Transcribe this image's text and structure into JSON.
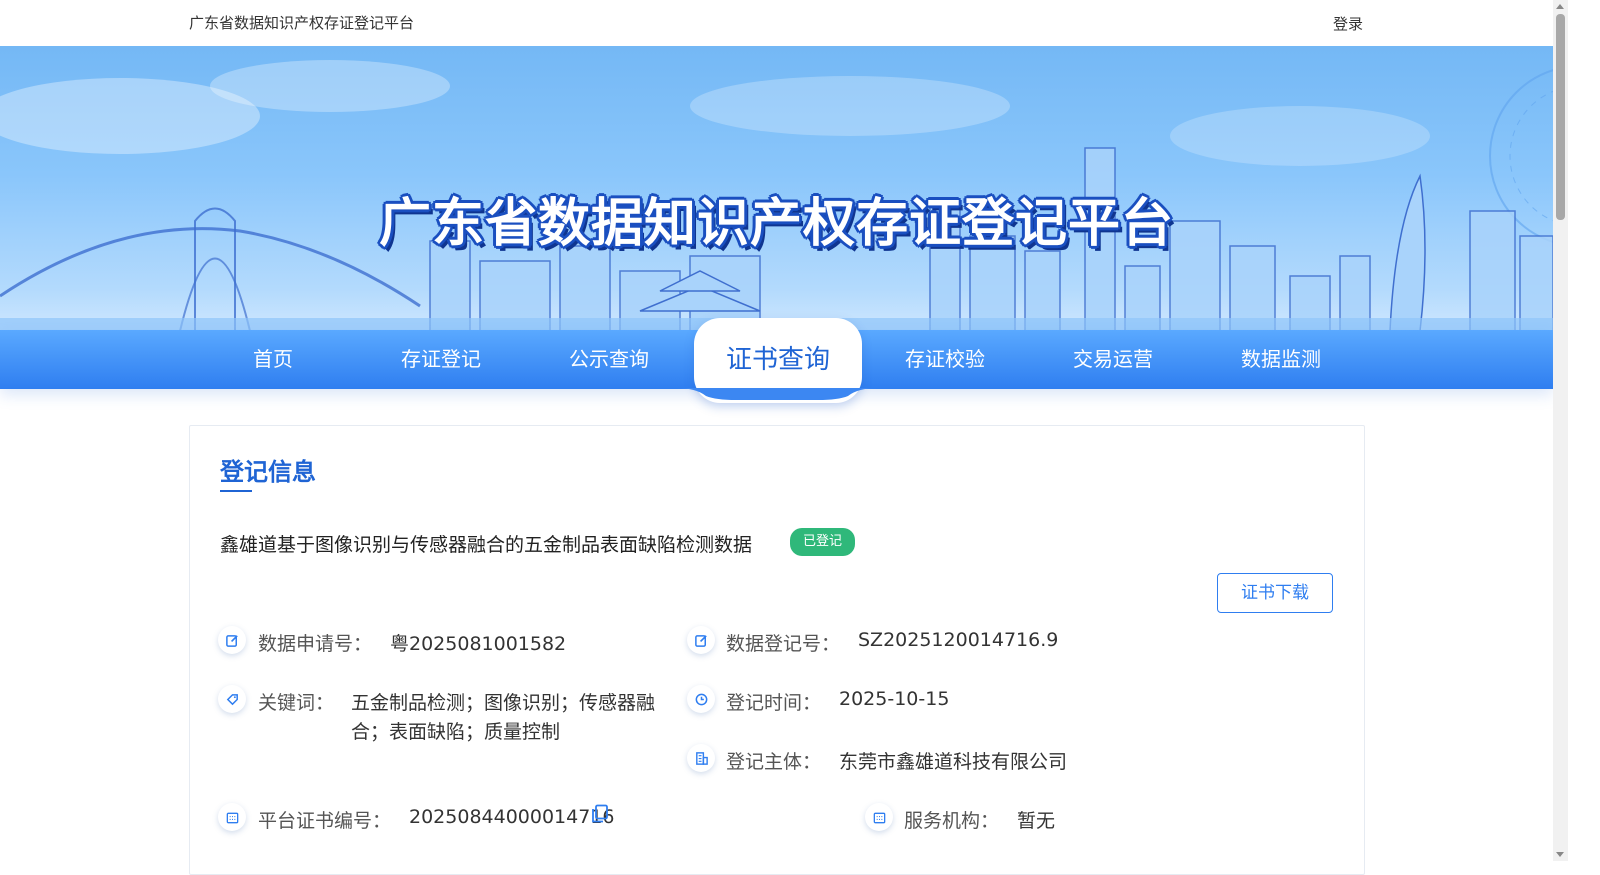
{
  "topbar": {
    "site_title": "广东省数据知识产权存证登记平台",
    "login_label": "登录"
  },
  "banner": {
    "title": "广东省数据知识产权存证登记平台"
  },
  "nav": {
    "items": [
      {
        "label": "首页",
        "active": false
      },
      {
        "label": "存证登记",
        "active": false
      },
      {
        "label": "公示查询",
        "active": false
      },
      {
        "label": "证书查询",
        "active": true
      },
      {
        "label": "存证校验",
        "active": false
      },
      {
        "label": "交易运营",
        "active": false
      },
      {
        "label": "数据监测",
        "active": false
      }
    ]
  },
  "section": {
    "title": "登记信息",
    "data_name": "鑫雄道基于图像识别与传感器融合的五金制品表面缺陷检测数据",
    "status": "已登记",
    "download_label": "证书下载"
  },
  "fields": {
    "application_no": {
      "label": "数据申请号：",
      "value": "粤2025081001582",
      "icon": "edit-icon"
    },
    "registration_no": {
      "label": "数据登记号：",
      "value": "SZ2025120014716.9",
      "icon": "edit-icon"
    },
    "keywords": {
      "label": "关键词：",
      "value_line1": "五金制品检测；图像识别；传感器融",
      "value_line2": "合；表面缺陷；质量控制",
      "icon": "tag-icon"
    },
    "registration_time": {
      "label": "登记时间：",
      "value": "2025-10-15",
      "icon": "clock-icon"
    },
    "registrant": {
      "label": "登记主体：",
      "value": "东莞市鑫雄道科技有限公司",
      "icon": "building-icon"
    },
    "certificate_no": {
      "label": "平台证书编号：",
      "value": "20250844000014716",
      "icon": "calendar-icon"
    },
    "service_org": {
      "label": "服务机构：",
      "value": "暂无",
      "icon": "calendar-icon"
    }
  },
  "colors": {
    "primary": "#1f64d4",
    "nav_gradient_top": "#5aa9ff",
    "nav_gradient_bottom": "#2f7ef0",
    "status_green": "#2fb87a"
  }
}
